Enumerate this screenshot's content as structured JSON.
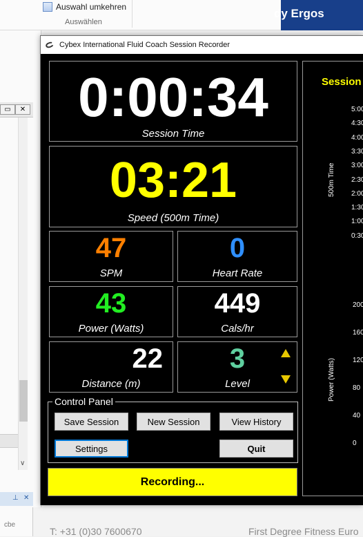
{
  "background": {
    "ribbon_command": "Auswahl umkehren",
    "ribbon_group": "Auswählen",
    "web_header": "dy Ergos",
    "footer_phone": "T: +31 (0)30 7600670",
    "footer_company": "First Degree Fitness Euro"
  },
  "window": {
    "title": "Cybex International Fluid Coach Session Recorder"
  },
  "metrics": {
    "session_time": {
      "value": "0:00:34",
      "label": "Session Time"
    },
    "speed": {
      "value": "03:21",
      "label": "Speed (500m Time)"
    },
    "spm": {
      "value": "47",
      "label": "SPM"
    },
    "heart_rate": {
      "value": "0",
      "label": "Heart Rate"
    },
    "power": {
      "value": "43",
      "label": "Power (Watts)"
    },
    "calories": {
      "value": "449",
      "label": "Cals/hr"
    },
    "distance": {
      "value": "22",
      "label": "Distance (m)"
    },
    "level": {
      "value": "3",
      "label": "Level"
    }
  },
  "control_panel": {
    "title": "Control Panel",
    "save_session": "Save Session",
    "new_session": "New Session",
    "view_history": "View History",
    "settings": "Settings",
    "quit": "Quit"
  },
  "status": "Recording...",
  "graph": {
    "title": "Session",
    "pace_axis_label": "500m Time",
    "pace_ticks": [
      "5:00",
      "4:30",
      "4:00",
      "3:30",
      "3:00",
      "2:30",
      "2:00",
      "1:30",
      "1:00",
      "0:30"
    ],
    "power_axis_label": "Power (Watts)",
    "power_ticks": [
      "200",
      "160",
      "120",
      "80",
      "40",
      "0"
    ]
  },
  "colors": {
    "speed": "#ffff00",
    "spm": "#ff8000",
    "heart_rate": "#2f8fff",
    "power": "#22ee22",
    "level": "#5fcf9f",
    "recording_bg": "#ffff00"
  }
}
